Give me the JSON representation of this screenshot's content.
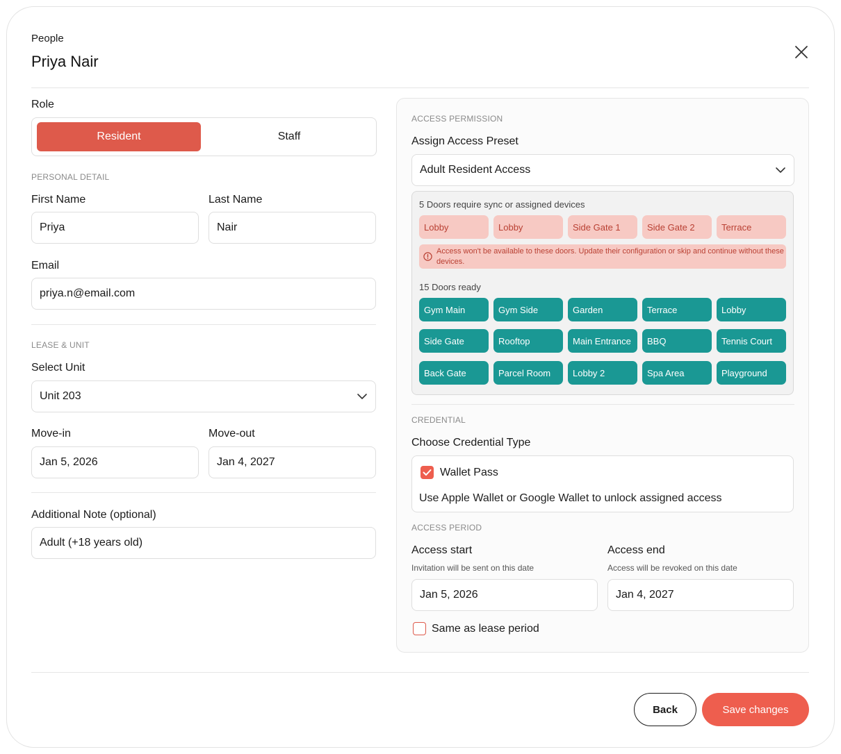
{
  "header": {
    "breadcrumb": "People",
    "title": "Priya Nair"
  },
  "role": {
    "label": "Role",
    "options": [
      "Resident",
      "Staff"
    ],
    "selected": "Resident"
  },
  "personal": {
    "section": "PERSONAL DETAIL",
    "first_name_label": "First Name",
    "first_name": "Priya",
    "last_name_label": "Last Name",
    "last_name": "Nair",
    "email_label": "Email",
    "email": "priya.n@email.com"
  },
  "lease": {
    "section": "LEASE & UNIT",
    "unit_label": "Select Unit",
    "unit": "Unit 203",
    "move_in_label": "Move-in",
    "move_in": "Jan 5, 2026",
    "move_out_label": "Move-out",
    "move_out": "Jan 4, 2027"
  },
  "note": {
    "label": "Additional Note (optional)",
    "value": "Adult (+18 years old)"
  },
  "access": {
    "section": "ACCESS PERMISSION",
    "preset_label": "Assign Access Preset",
    "preset": "Adult Resident Access",
    "sync_heading": "5 Doors require sync or assigned devices",
    "sync_doors": [
      "Lobby",
      "Lobby",
      "Side Gate 1",
      "Side Gate 2",
      "Terrace"
    ],
    "warning": "Access won't be available to these doors. Update their configuration or skip and continue without these devices.",
    "ready_heading": "15 Doors ready",
    "ready_doors": [
      "Gym Main",
      "Gym Side",
      "Garden",
      "Terrace",
      "Lobby",
      "Side Gate",
      "Rooftop",
      "Main Entrance",
      "BBQ",
      "Tennis Court",
      "Back Gate",
      "Parcel Room",
      "Lobby 2",
      "Spa Area",
      "Playground"
    ]
  },
  "credential": {
    "section": "CREDENTIAL",
    "type_label": "Choose Credential Type",
    "option": "Wallet Pass",
    "description": "Use Apple Wallet or Google Wallet to unlock assigned access",
    "checked": true
  },
  "period": {
    "section": "ACCESS PERIOD",
    "start_label": "Access start",
    "start_hint": "Invitation will be sent on this date",
    "start": "Jan 5, 2026",
    "end_label": "Access end",
    "end_hint": "Access will be revoked on this date",
    "end": "Jan 4, 2027",
    "same_as_lease": "Same as lease period",
    "same_checked": false
  },
  "footer": {
    "back": "Back",
    "save": "Save changes"
  },
  "colors": {
    "accent": "#de5a4b",
    "teal": "#1a9894",
    "warn_bg": "#f7c9c3",
    "warn_text": "#b94033"
  }
}
